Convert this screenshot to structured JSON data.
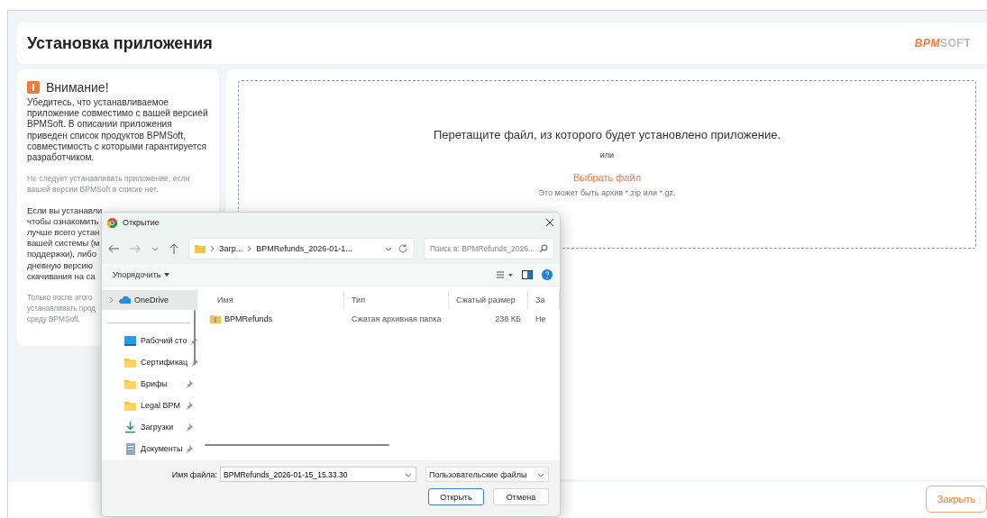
{
  "header": {
    "title": "Установка приложения",
    "logo": {
      "accent": "BPM",
      "rest": "SOFT"
    }
  },
  "notice": {
    "title": "Внимание!",
    "paragraphs": [
      {
        "kind": "body",
        "text": "Убедитесь, что устанавливаемое приложение совместимо с вашей версией BPMSoft. В описании приложения приведен список продуктов BPMSoft, совместимость с которыми гарантируется разработчиком."
      },
      {
        "kind": "note",
        "text": "Не следует устанавливать приложение, если вашей версии BPMSoft в списке нет."
      },
      {
        "kind": "body",
        "lines": [
          "Если вы устанавли",
          "чтобы ознакомить",
          "лучше всего устан",
          "вашей системы (м",
          "поддержки), либо",
          "дневную версию",
          "скачивания на са"
        ]
      },
      {
        "kind": "note",
        "lines": [
          "Только после этого",
          "устанавливать прод",
          "среду BPMSoft."
        ]
      }
    ]
  },
  "dropzone": {
    "prompt": "Перетащите файл, из которого будет установлено приложение.",
    "or": "или",
    "link": "Выбрать файл",
    "hint": "Это может быть архив *.zip или *.gz."
  },
  "footer": {
    "close_button": "Закрыть"
  },
  "dialog": {
    "title": "Открытие",
    "breadcrumb": [
      "Загр...",
      "BPMRefunds_2026-01-1..."
    ],
    "search": {
      "placeholder": "Поиск в: BPMRefunds_2026..."
    },
    "organize": "Упорядочить",
    "sidebar": [
      {
        "label": "OneDrive",
        "kind": "cloud",
        "selected": true,
        "pinned": false
      },
      {
        "label": "Рабочий сто",
        "kind": "desktop",
        "selected": false,
        "pinned": true
      },
      {
        "label": "Сертификац",
        "kind": "folder",
        "selected": false,
        "pinned": true
      },
      {
        "label": "Брифы",
        "kind": "folder",
        "selected": false,
        "pinned": true
      },
      {
        "label": "Legal BPM",
        "kind": "folder",
        "selected": false,
        "pinned": true
      },
      {
        "label": "Загрузки",
        "kind": "download",
        "selected": false,
        "pinned": true
      },
      {
        "label": "Документы",
        "kind": "document",
        "selected": false,
        "pinned": true
      }
    ],
    "columns": [
      "Имя",
      "Тип",
      "Сжатый размер",
      "За"
    ],
    "files": [
      {
        "name": "BPMRefunds",
        "type": "Сжатая архивная папка",
        "size": "238 КБ",
        "column_4": "Не"
      }
    ],
    "filename": {
      "label": "Имя файла:",
      "value": "BPMRefunds_2026-01-15_15.33.30"
    },
    "filetype": "Пользовательские файлы",
    "buttons": [
      {
        "label": "Открыть",
        "primary": true
      },
      {
        "label": "Отмена",
        "primary": false
      }
    ]
  }
}
